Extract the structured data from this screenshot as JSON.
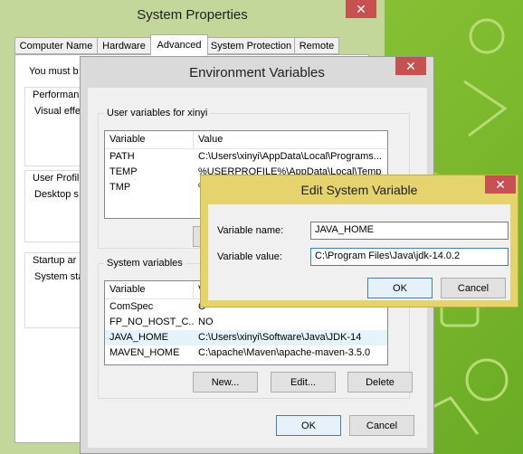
{
  "system_properties": {
    "title": "System Properties",
    "close": "✕",
    "tabs": [
      "Computer Name",
      "Hardware",
      "Advanced",
      "System Protection",
      "Remote"
    ],
    "must_text": "You must b",
    "groups": {
      "performance": {
        "title": "Performan",
        "body": "Visual effe"
      },
      "user_profiles": {
        "title": "User Profil",
        "body": "Desktop s"
      },
      "startup": {
        "title": "Startup ar",
        "body": "System sta"
      }
    }
  },
  "env_vars": {
    "title": "Environment Variables",
    "close": "✕",
    "user_group_title": "User variables for xinyi",
    "user_columns": [
      "Variable",
      "Value"
    ],
    "user_rows": [
      {
        "variable": "PATH",
        "value": "C:\\Users\\xinyi\\AppData\\Local\\Programs..."
      },
      {
        "variable": "TEMP",
        "value": "%USERPROFILE%\\AppData\\Local\\Temp"
      },
      {
        "variable": "TMP",
        "value": "%"
      }
    ],
    "system_group_title": "System variables",
    "system_columns": [
      "Variable",
      "V"
    ],
    "system_rows": [
      {
        "variable": "ComSpec",
        "value": "C"
      },
      {
        "variable": "FP_NO_HOST_C...",
        "value": "NO"
      },
      {
        "variable": "JAVA_HOME",
        "value": "C:\\Users\\xinyi\\Software\\Java\\JDK-14"
      },
      {
        "variable": "MAVEN_HOME",
        "value": "C:\\apache\\Maven\\apache-maven-3.5.0"
      }
    ],
    "buttons": {
      "new": "New...",
      "edit": "Edit...",
      "delete": "Delete"
    },
    "ok": "OK",
    "cancel": "Cancel"
  },
  "edit_var": {
    "title": "Edit System Variable",
    "close": "✕",
    "name_label": "Variable name:",
    "name_value": "JAVA_HOME",
    "value_label": "Variable value:",
    "value_value": "C:\\Program Files\\Java\\jdk-14.0.2",
    "ok": "OK",
    "cancel": "Cancel"
  },
  "colors": {
    "window_frame": "#c3d79a",
    "env_frame": "#b8b8b8",
    "dialog_frame": "#e6d06a",
    "close_red": "#c75050",
    "desktop_green": "#8ec63f"
  }
}
